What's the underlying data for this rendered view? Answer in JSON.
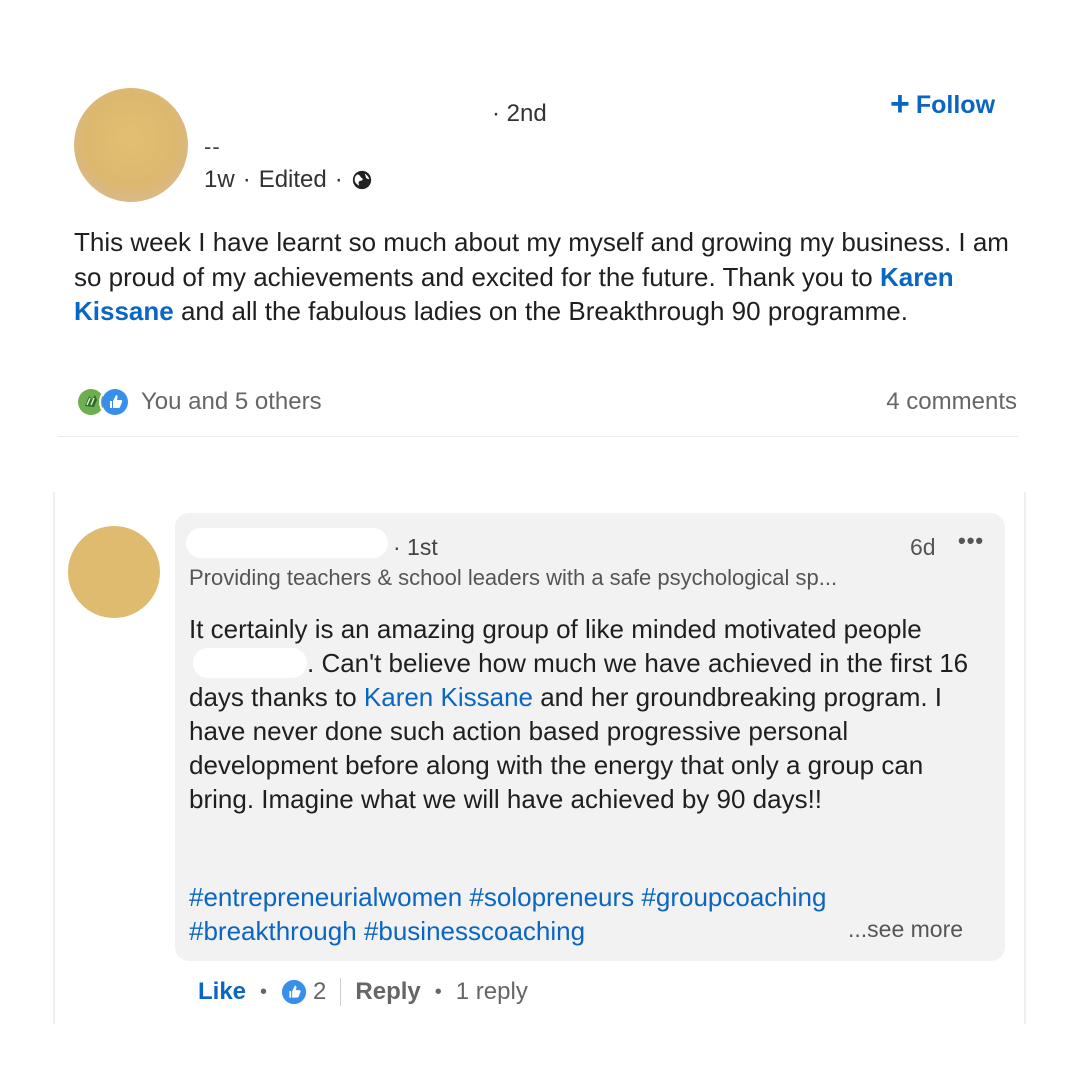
{
  "post": {
    "author_degree": "· 2nd",
    "follow_label": "Follow",
    "headline": "--",
    "time": "1w",
    "edited": "Edited",
    "body_intro": "This week I have learnt so much about my myself and growing my business. I am so proud of my achievements and excited for the future. Thank you to ",
    "mention": "Karen Kissane",
    "body_outro": " and all the fabulous ladies on the Breakthrough 90 programme.",
    "reactions_text": "You and 5 others",
    "comments_count": "4 comments",
    "icons": [
      "globe-icon",
      "celebrate-icon",
      "like-icon"
    ]
  },
  "comment": {
    "degree": "· 1st",
    "time": "6d",
    "more": "•••",
    "headline": "Providing teachers & school leaders with a safe psychological sp...",
    "body_part1": "It certainly is an amazing group of like minded motivated people",
    "body_part2": ". Can't believe how much we have achieved in the first 16 days thanks to ",
    "mention": "Karen Kissane",
    "body_part3": " and her groundbreaking program. I have never done such action based progressive personal development before along with the energy that only a group can bring. Imagine what we will have achieved by 90 days!!",
    "hashtags": [
      "#entrepreneurialwomen",
      "#solopreneurs",
      "#groupcoaching",
      "#breakthrough",
      "#businesscoaching"
    ],
    "see_more": "...see more",
    "like_label": "Like",
    "like_count": "2",
    "reply_label": "Reply",
    "replies": "1 reply"
  },
  "colors": {
    "accent": "#0a66c2",
    "avatar": "#dfbb70",
    "bubble": "#f2f2f2"
  }
}
